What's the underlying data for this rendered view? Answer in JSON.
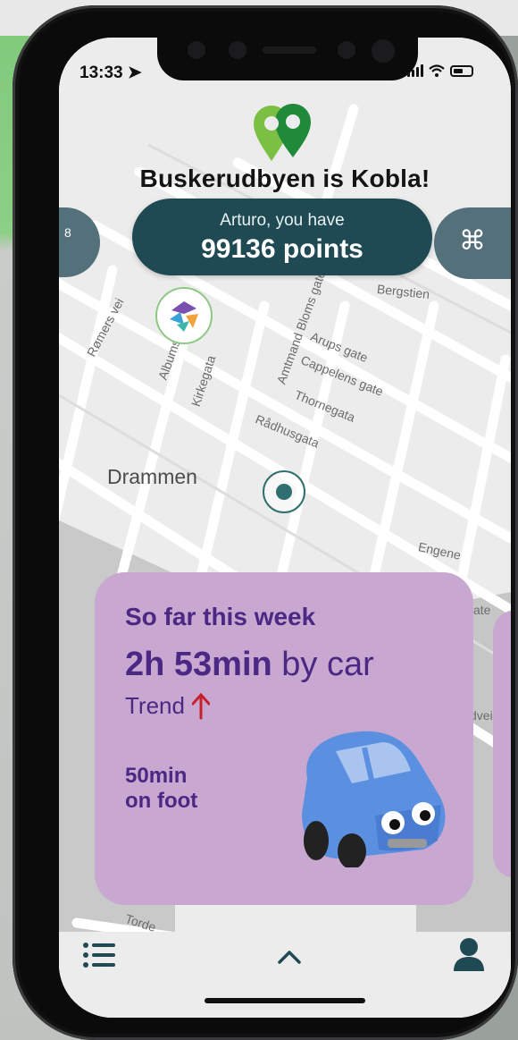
{
  "status": {
    "time": "13:33"
  },
  "app": {
    "title": "Buskerudbyen is Kobla!"
  },
  "points": {
    "greeting": "Arturo, you have",
    "value": "99136 points"
  },
  "side_buttons": {
    "left_label": "8",
    "right_icon": "command-icon"
  },
  "map": {
    "city": "Drammen",
    "streets": [
      "Bergstien",
      "Arups gate",
      "Cappelens gate",
      "Thornegata",
      "Rådhusgata",
      "Amtmand Bloms gate",
      "Kirkegata",
      "Albums",
      "Rømers vei",
      "Engene",
      "Torde",
      "ate",
      "dveie"
    ]
  },
  "weekly_card": {
    "title": "So far this week",
    "car_duration": "2h 53min",
    "car_suffix": "by car",
    "trend_label": "Trend",
    "trend_direction": "up",
    "foot_duration": "50min",
    "foot_suffix": "on foot"
  },
  "bottom_nav": {
    "left": "list-icon",
    "center": "chevron-up-icon",
    "right": "user-icon"
  },
  "colors": {
    "pill": "#1f4a53",
    "card": "#c8a8d0",
    "card_text": "#4a2883",
    "trend_arrow": "#c8202a",
    "brand_green": "#2e9b3e"
  }
}
